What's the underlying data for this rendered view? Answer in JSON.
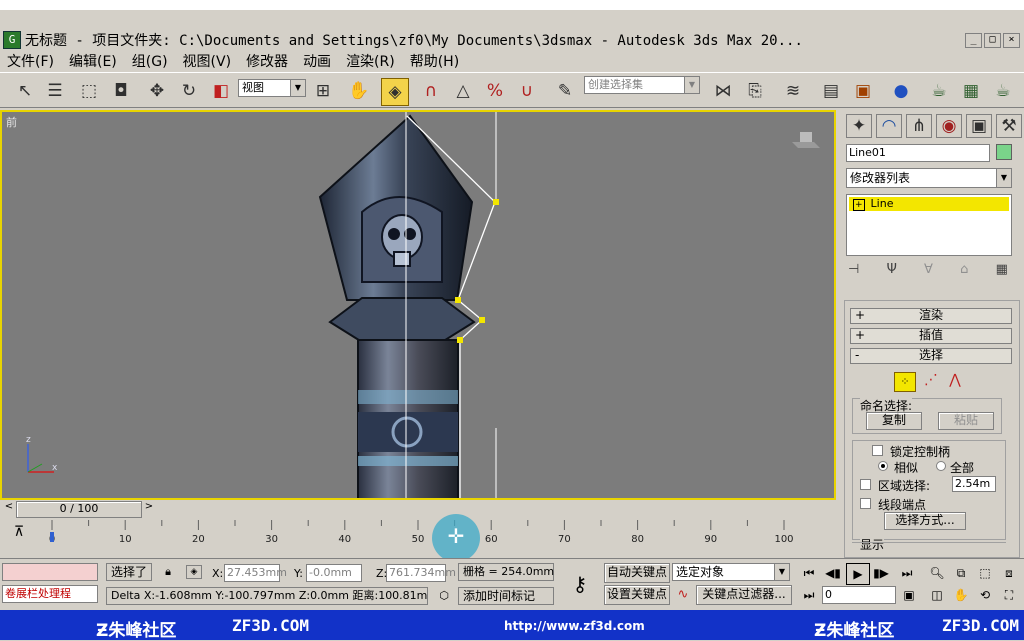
{
  "window": {
    "title": "无标题    - 项目文件夹: C:\\Documents and Settings\\zf0\\My Documents\\3dsmax    - Autodesk 3ds Max  20...",
    "minimize": "_",
    "maximize": "□",
    "close": "×"
  },
  "menu": [
    "文件(F)",
    "编辑(E)",
    "组(G)",
    "视图(V)",
    "修改器",
    "动画",
    "渲染(R)",
    "帮助(H)"
  ],
  "toolbar": {
    "view_combo": "视图",
    "selection_set_placeholder": "创建选择集"
  },
  "viewport": {
    "label": "前",
    "axis_z": "z",
    "axis_x": "x"
  },
  "command_panel": {
    "object_name": "Line01",
    "modifier_list": "修改器列表",
    "stack_item": "Line",
    "rollouts": [
      {
        "sign": "+",
        "label": "渲染"
      },
      {
        "sign": "+",
        "label": "插值"
      },
      {
        "sign": "-",
        "label": "选择"
      }
    ],
    "named_selection_label": "命名选择:",
    "copy_button": "复制",
    "paste_button": "粘贴",
    "lock_handles": "锁定控制柄",
    "similar": "相似",
    "all": "全部",
    "area_select": "区域选择:",
    "area_value": "2.54m",
    "segment_end": "线段端点",
    "select_by": "选择方式...",
    "display_label": "显示"
  },
  "timeline": {
    "slider_label": "0 / 100",
    "ticks": [
      "0",
      "10",
      "20",
      "30",
      "40",
      "50",
      "60",
      "70",
      "80",
      "90",
      "100"
    ]
  },
  "status": {
    "maxscript_label": "卷展栏处理程",
    "selected": "选择了",
    "x_label": "X:",
    "x_value": "27.453mm",
    "y_label": "Y:",
    "y_value": "-0.0mm",
    "z_label": "Z:",
    "z_value": "761.734mm",
    "grid": "栅格 = 254.0mm",
    "delta_line": "Delta X:-1.608mm  Y:-100.797mm  Z:0.0mm  距离:100.81mm",
    "add_time_tag": "添加时间标记",
    "auto_key": "自动关键点",
    "set_key": "设置关键点",
    "selected_object": "选定对象",
    "key_filters": "关键点过滤器...",
    "frame_value": "0"
  },
  "watermark": {
    "left": "朱峰社区",
    "left_url": "ZF3D.COM",
    "center": "http://www.zf3d.com",
    "right": "朱峰社区",
    "right_url": "ZF3D.COM"
  },
  "colors": {
    "viewport_bg": "#7c7c7c",
    "viewport_border": "#e8d400",
    "highlight": "#f3e600",
    "watermark_bar": "#1232c8"
  }
}
